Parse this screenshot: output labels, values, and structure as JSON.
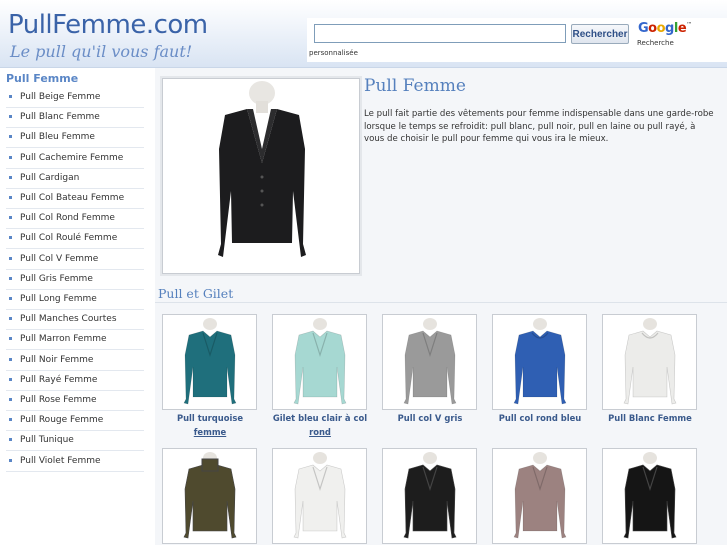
{
  "header": {
    "logo_title": "PullFemme.com",
    "logo_tagline": "Le pull qu'il vous faut!",
    "search": {
      "placeholder": "",
      "button_label": "Rechercher",
      "note": "personnalisée",
      "google_label": "Google",
      "google_tm": "™",
      "google_sub": "Recherche"
    }
  },
  "sidebar": {
    "title": "Pull Femme",
    "items": [
      {
        "label": "Pull Beige Femme"
      },
      {
        "label": "Pull Blanc Femme"
      },
      {
        "label": "Pull Bleu Femme"
      },
      {
        "label": "Pull Cachemire Femme"
      },
      {
        "label": "Pull Cardigan"
      },
      {
        "label": "Pull Col Bateau Femme"
      },
      {
        "label": "Pull Col Rond Femme"
      },
      {
        "label": "Pull Col Roulé Femme"
      },
      {
        "label": "Pull Col V Femme"
      },
      {
        "label": "Pull Gris Femme"
      },
      {
        "label": "Pull Long Femme"
      },
      {
        "label": "Pull Manches Courtes"
      },
      {
        "label": "Pull Marron Femme"
      },
      {
        "label": "Pull Noir Femme"
      },
      {
        "label": "Pull Rayé Femme"
      },
      {
        "label": "Pull Rose Femme"
      },
      {
        "label": "Pull Rouge Femme"
      },
      {
        "label": "Pull Tunique"
      },
      {
        "label": "Pull Violet Femme"
      }
    ]
  },
  "main": {
    "title": "Pull Femme",
    "intro": "Le pull fait partie des vêtements pour femme indispensable dans une garde-robe lorsque le temps se refroidit: pull blanc, pull noir, pull en laine ou pull rayé, à vous de choisir le pull pour femme qui vous ira le mieux.",
    "section_title": "Pull et Gilet",
    "products_row1": [
      {
        "line1": "Pull turquoise",
        "line2": "femme",
        "color": "#1f6f7c",
        "icon": "turquoise-sweater"
      },
      {
        "line1": "Gilet bleu clair à col",
        "line2": "rond",
        "color": "#a6d8d2",
        "icon": "light-blue-cardigan"
      },
      {
        "line1": "Pull col V gris",
        "line2": "",
        "color": "#9a9a9a",
        "icon": "grey-sweater"
      },
      {
        "line1": "Pull col rond bleu",
        "line2": "",
        "color": "#2f5fb3",
        "icon": "blue-sweater"
      },
      {
        "line1": "Pull Blanc Femme",
        "line2": "",
        "color": "#ececea",
        "icon": "white-sweater"
      }
    ],
    "products_row2": [
      {
        "color": "#4f4a2e",
        "icon": "olive-turtleneck"
      },
      {
        "color": "#f0f0ee",
        "icon": "white-cardigan"
      },
      {
        "color": "#1d1d1d",
        "icon": "black-cardigan"
      },
      {
        "color": "#9c8280",
        "icon": "long-cardigan"
      },
      {
        "color": "#151515",
        "icon": "black-buttoned-cardigan"
      }
    ],
    "hero_icon": "black-cardigan"
  },
  "colors": {
    "brand_blue": "#3a63a8",
    "heading_blue": "#5580bd"
  }
}
